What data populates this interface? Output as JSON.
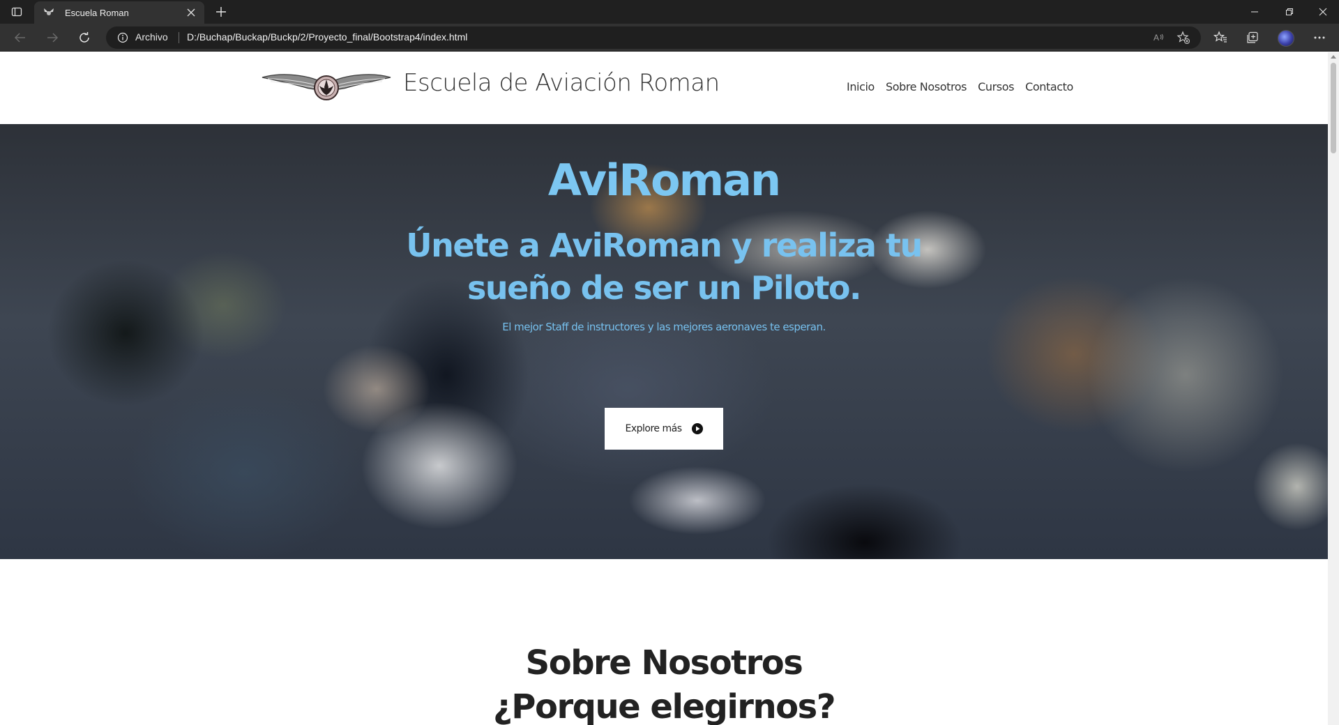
{
  "browser": {
    "tab_title": "Escuela Roman",
    "address_chip": "Archivo",
    "url": "D:/Buchap/Buckap/Buckp/2/Proyecto_final/Bootstrap4/index.html",
    "icons": [
      "tab-actions-icon",
      "close-icon",
      "new-tab-icon",
      "minimize-icon",
      "restore-icon",
      "close-window-icon",
      "back-icon",
      "forward-icon",
      "refresh-icon",
      "info-icon",
      "read-aloud-icon",
      "add-favorite-icon",
      "favorites-icon",
      "collections-icon",
      "profile-avatar",
      "more-icon"
    ]
  },
  "site": {
    "brand": "Escuela de Aviación Roman",
    "nav": [
      "Inicio",
      "Sobre Nosotros",
      "Cursos",
      "Contacto"
    ]
  },
  "hero": {
    "title": "AviRoman",
    "subtitle": "Únete a AviRoman y realiza tu sueño de ser un Piloto.",
    "text": "El mejor Staff de instructores y las mejores aeronaves te esperan.",
    "button_label": "Explore más",
    "accent_color": "#7cc7f2"
  },
  "about": {
    "title": "Sobre Nosotros",
    "subtitle": "¿Porque elegirnos?"
  }
}
